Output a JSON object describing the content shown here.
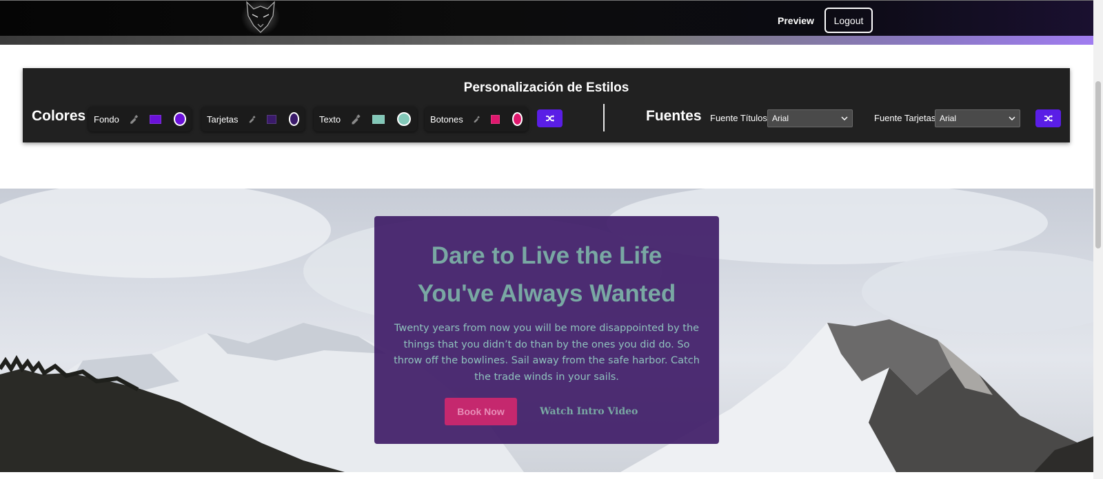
{
  "navbar": {
    "preview_label": "Preview",
    "logout_label": "Logout"
  },
  "customizer": {
    "title": "Personalización de Estilos",
    "colors_label": "Colores",
    "color_groups": [
      {
        "label": "Fondo",
        "swatch": "#6a11d9",
        "circle": "#6a11d9"
      },
      {
        "label": "Tarjetas",
        "swatch": "#3a1a6a",
        "circle": "#3a1a6a"
      },
      {
        "label": "Texto",
        "swatch": "#82c8b8",
        "circle": "#82c8b8"
      },
      {
        "label": "Botones",
        "swatch": "#e0186e",
        "circle": "#e0186e"
      }
    ],
    "fonts_label": "Fuentes",
    "title_font_label": "Fuente Títulos",
    "title_font_value": "Arial",
    "card_font_label": "Fuente Tarjetas",
    "card_font_value": "Arial",
    "accent_color": "#5a1ee6"
  },
  "hero": {
    "title_line1": "Dare to Live the Life",
    "title_line2": "You've Always Wanted",
    "text": "Twenty years from now you will be more disappointed by the things that you didn’t do than by the ones you did do. So throw off the bowlines. Sail away from the safe harbor. Catch the trade winds in your sails.",
    "book_button": "Book Now",
    "video_link": "Watch Intro Video",
    "card_color": "#3f1c67",
    "text_color": "#79a8a3",
    "button_color": "#c5286e"
  }
}
